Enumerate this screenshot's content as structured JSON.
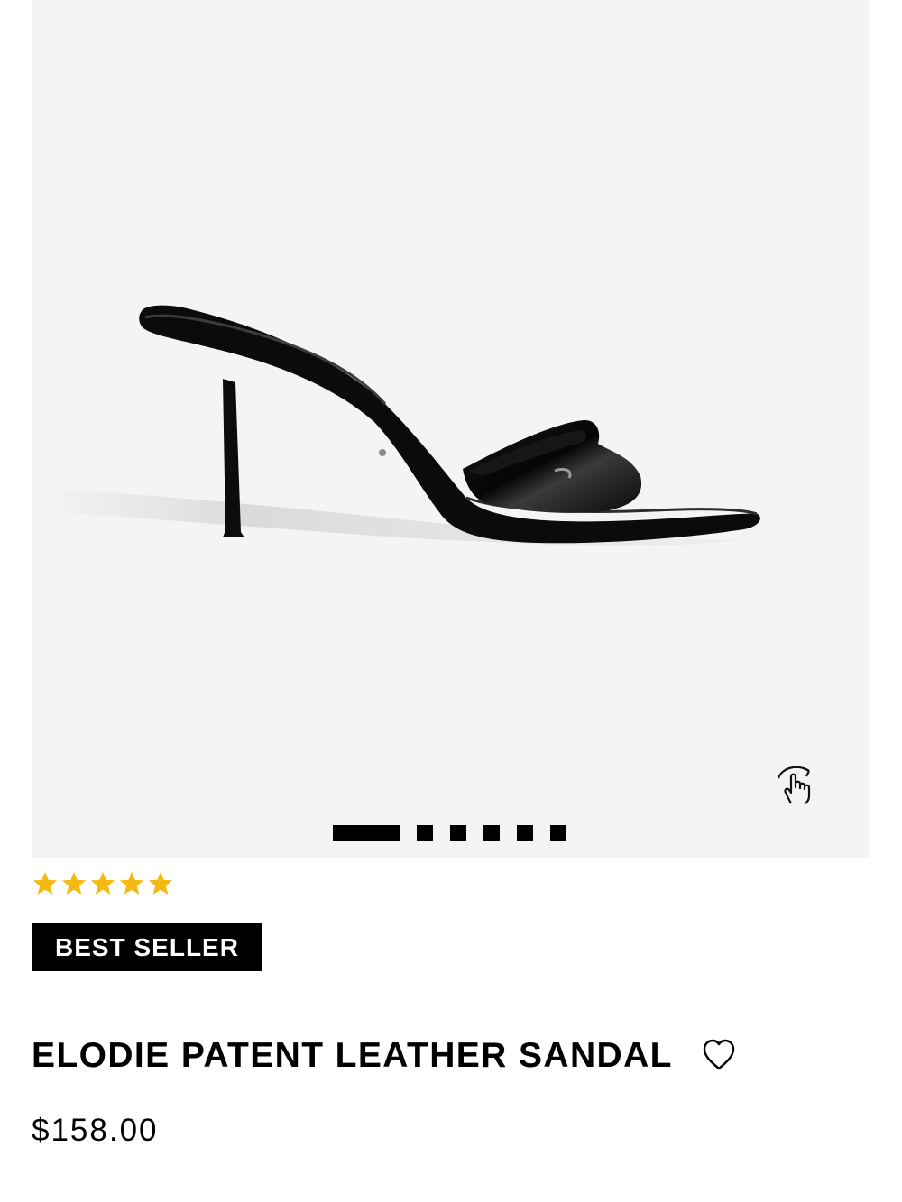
{
  "product": {
    "name": "ELODIE PATENT LEATHER SANDAL",
    "price": "$158.00",
    "badge": "BEST SELLER",
    "rating": {
      "value": 5,
      "max": 5,
      "star_color": "#f5b914"
    }
  },
  "gallery": {
    "image_count": 6,
    "active_index": 0,
    "background": "#f4f4f4",
    "rotate_icon": "360-rotate-hand-icon"
  },
  "icons": {
    "wishlist": "heart-outline-icon"
  }
}
